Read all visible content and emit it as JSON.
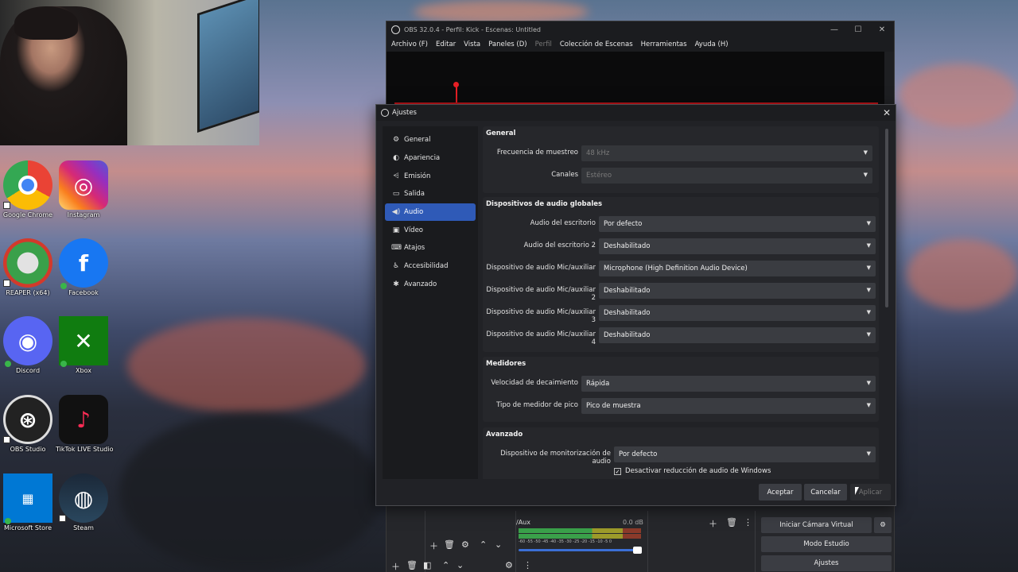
{
  "desktop": {
    "icons": [
      {
        "label": "Google Chrome",
        "color": "#4285f4"
      },
      {
        "label": "Instagram",
        "color": "#d6249f"
      },
      {
        "label": "REAPER (x64)",
        "color": "#2e9e3e"
      },
      {
        "label": "Facebook",
        "color": "#1877f2"
      },
      {
        "label": "Discord",
        "color": "#5865f2"
      },
      {
        "label": "Xbox",
        "color": "#107c10"
      },
      {
        "label": "OBS Studio",
        "color": "#1b1b1b"
      },
      {
        "label": "TikTok LIVE Studio",
        "color": "#111111"
      },
      {
        "label": "Microsoft Store",
        "color": "#0078d4"
      },
      {
        "label": "Steam",
        "color": "#1b2838"
      }
    ]
  },
  "obs": {
    "title": "OBS 32.0.4 - Perfil: Kick - Escenas: Untitled",
    "menu": [
      "Archivo (F)",
      "Editar",
      "Vista",
      "Paneles (D)",
      "Perfil",
      "Colección de Escenas",
      "Herramientas",
      "Ayuda (H)"
    ],
    "mixer": {
      "channel": "/Aux",
      "level": "0.0 dB",
      "scale": "-60 -55 -50 -45 -40 -35 -30 -25 -20 -15 -10 -5 0"
    },
    "controls": [
      "Iniciar Cámara Virtual",
      "Modo Estudio",
      "Ajustes"
    ]
  },
  "settings": {
    "title": "Ajustes",
    "sidebar": [
      {
        "label": "General",
        "icon": "gear-icon",
        "glyph": "⚙"
      },
      {
        "label": "Apariencia",
        "icon": "brush-icon",
        "glyph": "◐"
      },
      {
        "label": "Emisión",
        "icon": "broadcast-icon",
        "glyph": "📶"
      },
      {
        "label": "Salida",
        "icon": "output-icon",
        "glyph": "▭"
      },
      {
        "label": "Audio",
        "icon": "speaker-icon",
        "glyph": "🔊"
      },
      {
        "label": "Vídeo",
        "icon": "monitor-icon",
        "glyph": "▣"
      },
      {
        "label": "Atajos",
        "icon": "keyboard-icon",
        "glyph": "⌨"
      },
      {
        "label": "Accesibilidad",
        "icon": "accessibility-icon",
        "glyph": "♿"
      },
      {
        "label": "Avanzado",
        "icon": "tools-icon",
        "glyph": "✱"
      }
    ],
    "active": "Audio",
    "general": {
      "title": "General",
      "sample_rate_label": "Frecuencia de muestreo",
      "sample_rate": "48 kHz",
      "channels_label": "Canales",
      "channels": "Estéreo"
    },
    "global_devices": {
      "title": "Dispositivos de audio globales",
      "rows": [
        {
          "label": "Audio del escritorio",
          "value": "Por defecto"
        },
        {
          "label": "Audio del escritorio 2",
          "value": "Deshabilitado"
        },
        {
          "label": "Dispositivo de audio Mic/auxiliar",
          "value": "Microphone (High Definition Audio Device)"
        },
        {
          "label": "Dispositivo de audio Mic/auxiliar 2",
          "value": "Deshabilitado"
        },
        {
          "label": "Dispositivo de audio Mic/auxiliar 3",
          "value": "Deshabilitado"
        },
        {
          "label": "Dispositivo de audio Mic/auxiliar 4",
          "value": "Deshabilitado"
        }
      ]
    },
    "meters": {
      "title": "Medidores",
      "decay_label": "Velocidad de decaimiento",
      "decay": "Rápida",
      "peak_label": "Tipo de medidor de pico",
      "peak": "Pico de muestra"
    },
    "advanced": {
      "title": "Avanzado",
      "monitor_label": "Dispositivo de monitorización de audio",
      "monitor": "Por defecto",
      "ducking_label": "Desactivar reducción de audio de Windows"
    },
    "buttons": {
      "accept": "Aceptar",
      "cancel": "Cancelar",
      "apply": "Aplicar"
    }
  }
}
